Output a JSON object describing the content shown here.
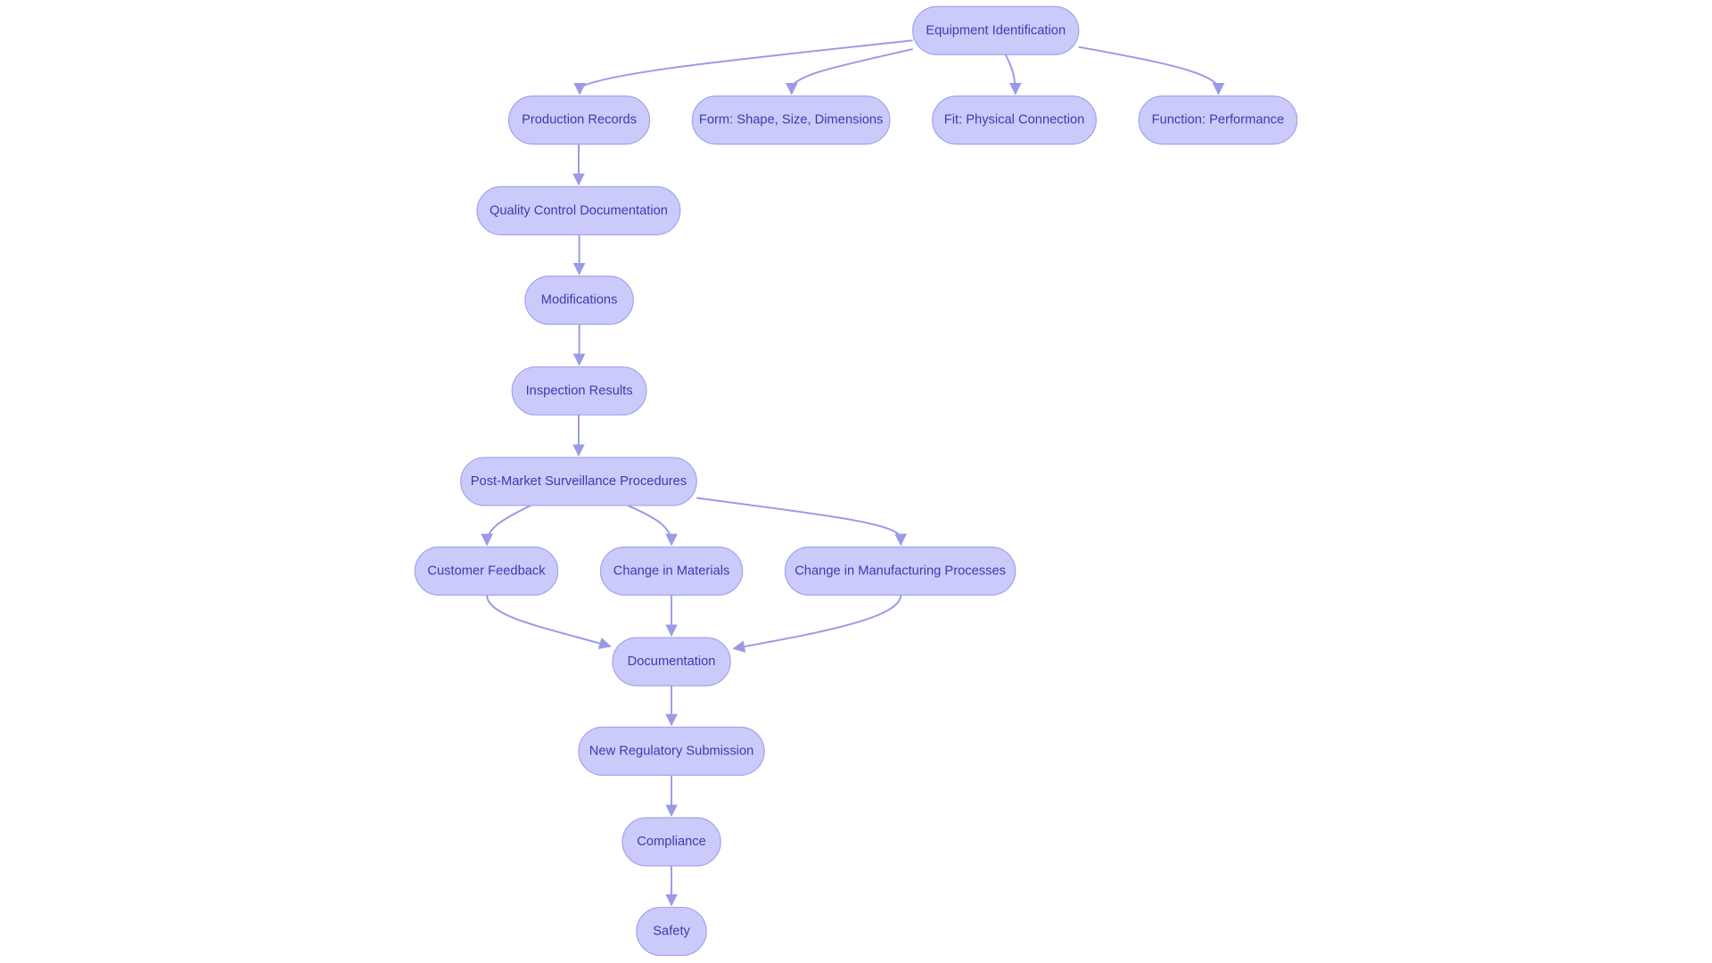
{
  "diagram": {
    "colors": {
      "node_fill": "#cbcbfb",
      "node_stroke": "#a3a3ee",
      "text": "#3b3bb0",
      "edge": "#9a9ae6"
    },
    "nodes": [
      {
        "id": "equip",
        "label": "Equipment Identification"
      },
      {
        "id": "prod",
        "label": "Production Records"
      },
      {
        "id": "form",
        "label": "Form: Shape, Size, Dimensions"
      },
      {
        "id": "fit",
        "label": "Fit: Physical Connection"
      },
      {
        "id": "func",
        "label": "Function: Performance"
      },
      {
        "id": "qc",
        "label": "Quality Control Documentation"
      },
      {
        "id": "mod",
        "label": "Modifications"
      },
      {
        "id": "insp",
        "label": "Inspection Results"
      },
      {
        "id": "pms",
        "label": "Post-Market Surveillance Procedures"
      },
      {
        "id": "cf",
        "label": "Customer Feedback"
      },
      {
        "id": "cm",
        "label": "Change in Materials"
      },
      {
        "id": "cmp",
        "label": "Change in Manufacturing Processes"
      },
      {
        "id": "doc",
        "label": "Documentation"
      },
      {
        "id": "nrs",
        "label": "New Regulatory Submission"
      },
      {
        "id": "comp",
        "label": "Compliance"
      },
      {
        "id": "safe",
        "label": "Safety"
      }
    ],
    "edges": [
      [
        "equip",
        "prod"
      ],
      [
        "equip",
        "form"
      ],
      [
        "equip",
        "fit"
      ],
      [
        "equip",
        "func"
      ],
      [
        "prod",
        "qc"
      ],
      [
        "qc",
        "mod"
      ],
      [
        "mod",
        "insp"
      ],
      [
        "insp",
        "pms"
      ],
      [
        "pms",
        "cf"
      ],
      [
        "pms",
        "cm"
      ],
      [
        "pms",
        "cmp"
      ],
      [
        "cf",
        "doc"
      ],
      [
        "cm",
        "doc"
      ],
      [
        "cmp",
        "doc"
      ],
      [
        "doc",
        "nrs"
      ],
      [
        "nrs",
        "comp"
      ],
      [
        "comp",
        "safe"
      ]
    ]
  }
}
